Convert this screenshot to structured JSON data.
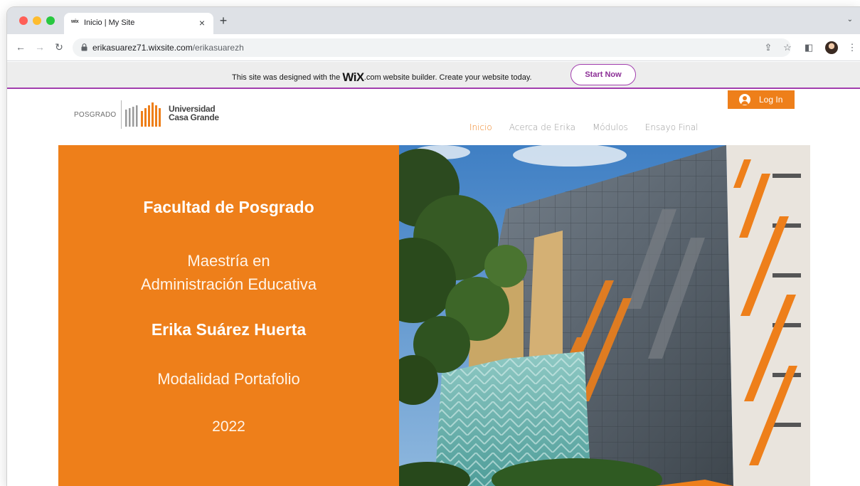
{
  "browser": {
    "tab_title": "Inicio | My Site",
    "tab_favicon": "wix",
    "tab_close": "×",
    "new_tab": "+",
    "url_host": "erikasuarez71.wixsite.com",
    "url_path": "/erikasuarezh",
    "icons": [
      "back-arrow-icon",
      "forward-arrow-icon",
      "reload-icon",
      "lock-icon",
      "share-icon",
      "star-icon",
      "side-panel-icon",
      "profile-avatar",
      "kebab-menu-icon"
    ]
  },
  "wix_banner": {
    "text_before": "This site was designed with the ",
    "logo": "WiX",
    "text_after": ".com website builder. Create your website today.",
    "button_label": "Start Now",
    "accent_color": "#a23eae"
  },
  "site": {
    "logo_left": "POSGRADO",
    "logo_line1": "Universidad",
    "logo_line2": "Casa Grande",
    "login_label": "Log In",
    "nav": [
      {
        "label": "Inicio",
        "active": true
      },
      {
        "label": "Acerca de Erika",
        "active": false
      },
      {
        "label": "Módulos",
        "active": false
      },
      {
        "label": "Ensayo Final",
        "active": false
      }
    ],
    "brand_color": "#ee7f1a"
  },
  "hero": {
    "faculty": "Facultad de Posgrado",
    "master_line1": "Maestría en",
    "master_line2": "Administración Educativa",
    "name": "Erika Suárez Huerta",
    "mode": "Modalidad Portafolio",
    "year": "2022"
  }
}
